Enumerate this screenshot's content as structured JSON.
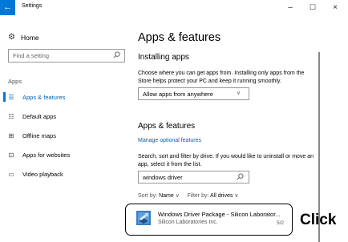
{
  "window": {
    "back": "←",
    "title": "Settings",
    "minimize": "–",
    "maximize": "☐",
    "close": "×"
  },
  "sidebar": {
    "home_label": "Home",
    "search_placeholder": "Find a setting",
    "section_label": "Apps",
    "items": [
      {
        "label": "Apps & features",
        "icon": "apps-list-icon",
        "active": true
      },
      {
        "label": "Default apps",
        "icon": "default-apps-icon",
        "active": false
      },
      {
        "label": "Offline maps",
        "icon": "map-icon",
        "active": false
      },
      {
        "label": "Apps for websites",
        "icon": "web-app-icon",
        "active": false
      },
      {
        "label": "Video playback",
        "icon": "video-icon",
        "active": false
      }
    ]
  },
  "main": {
    "title": "Apps & features",
    "installing": {
      "heading": "Installing apps",
      "description": "Choose where you can get apps from. Installing only apps from the Store helps protect your PC and keep it running smoothly.",
      "dropdown_value": "Allow apps from anywhere"
    },
    "features": {
      "heading": "Apps & features",
      "optional_link": "Manage optional features",
      "description": "Search, sort and filter by drive. If you would like to uninstall or move an app, select it from the list.",
      "search_value": "windows driver",
      "sort_label": "Sort by:",
      "sort_value": "Name",
      "filter_label": "Filter by:",
      "filter_value": "All drives"
    },
    "app": {
      "name": "Windows Driver Package - Silicon Laborator...",
      "publisher": "Silicon Laboratories Inc.",
      "date": "5/2"
    }
  },
  "annotation": {
    "click": "Click"
  },
  "colors": {
    "accent": "#0078d7",
    "link": "#0063b1"
  }
}
